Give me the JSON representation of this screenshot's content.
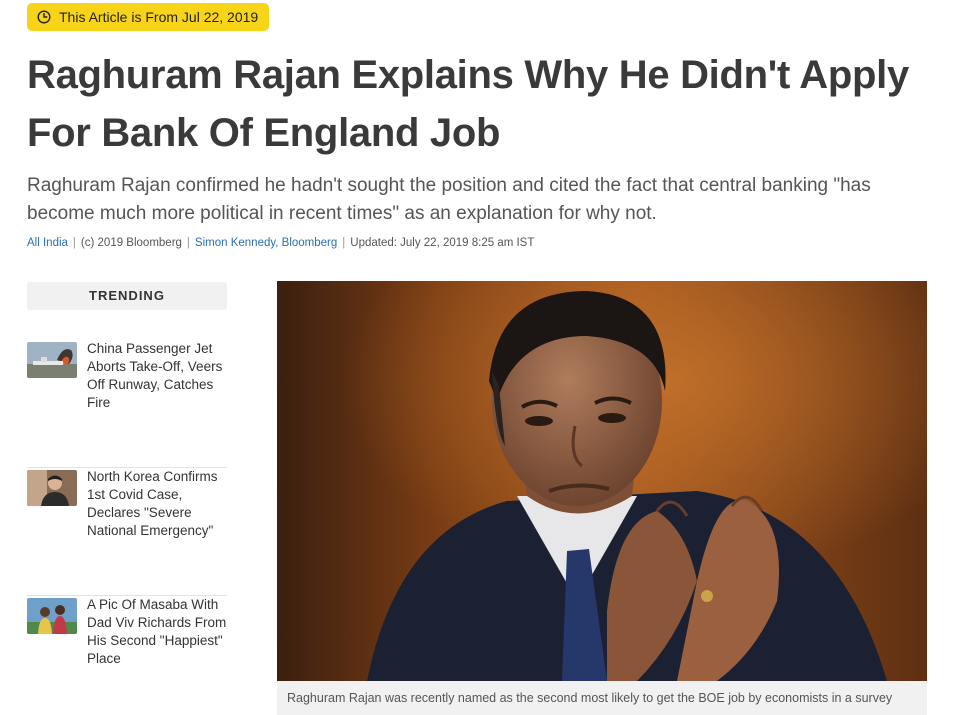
{
  "date_badge": {
    "text": "This Article is From Jul 22, 2019",
    "icon": "clock-icon",
    "color": "#f7d417"
  },
  "article": {
    "headline": "Raghuram Rajan Explains Why He Didn't Apply For Bank Of England Job",
    "summary": "Raghuram Rajan confirmed he hadn't sought the position and cited the fact that central banking \"has become much more political in recent times\" as an explanation for why not.",
    "byline": {
      "category": "All India",
      "copyright": "(c) 2019 Bloomberg",
      "author": "Simon Kennedy, Bloomberg",
      "updated": "Updated: July 22, 2019 8:25 am IST",
      "link_color": "#2a6fb0"
    },
    "image": {
      "caption": "Raghuram Rajan was recently named as the second most likely to get the BOE job by economists in a survey"
    }
  },
  "sidebar": {
    "heading": "TRENDING",
    "items": [
      {
        "title": "China Passenger Jet Aborts Take-Off, Veers Off Runway, Catches Fire"
      },
      {
        "title": "North Korea Confirms 1st Covid Case, Declares \"Severe National Emergency\""
      },
      {
        "title": "A Pic Of Masaba With Dad Viv Richards From His Second \"Happiest\" Place"
      }
    ]
  }
}
